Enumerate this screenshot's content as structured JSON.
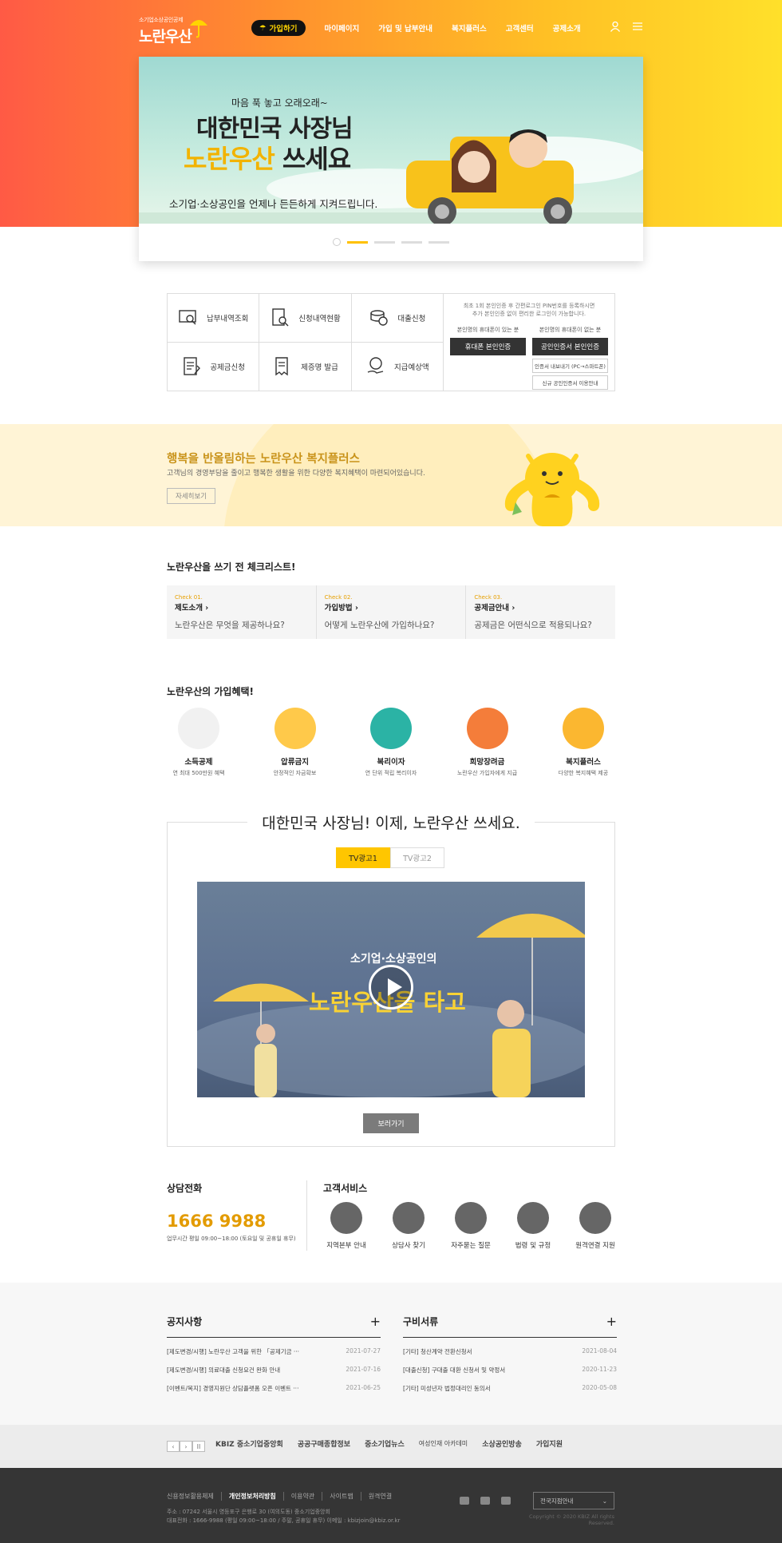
{
  "header": {
    "logo_small": "소기업소상공인공제",
    "logo_main": "노란우산",
    "join_label": "가입하기",
    "nav": [
      "마이페이지",
      "가입 및 납부안내",
      "복지플러스",
      "고객센터",
      "공제소개"
    ]
  },
  "banner": {
    "small": "마음 푹 놓고 오래오래~",
    "title1": "대한민국 사장님",
    "title2a": "노란우산",
    "title2b": "쓰세요",
    "subtitle": "소기업·소상공인을 언제나 든든하게 지켜드립니다."
  },
  "services": {
    "items": [
      {
        "label": "납부내역조회",
        "icon": "monitor-search-icon"
      },
      {
        "label": "신청내역현황",
        "icon": "document-search-icon"
      },
      {
        "label": "대출신청",
        "icon": "coin-stack-icon"
      },
      {
        "label": "공제금신청",
        "icon": "document-pen-icon"
      },
      {
        "label": "제증명 발급",
        "icon": "certificate-icon"
      },
      {
        "label": "지급예상액",
        "icon": "money-hand-icon"
      }
    ],
    "auth_note1": "최초 1회 본인인증 후 간편로그인 PIN번호를 등록하시면",
    "auth_note2": "추가 본인인증 없이 편리한 로그인이 가능합니다.",
    "auth_left_label": "본인명의 휴대폰이 있는 분",
    "auth_right_label": "본인명의 휴대폰이 없는 분",
    "auth_phone_btn": "휴대폰 본인인증",
    "auth_cert_btn": "공인인증서 본인인증",
    "auth_cert_export": "인증서 내보내기 (PC→스마트폰)",
    "auth_cert_guide": "신규 공인인증서 이용안내"
  },
  "welfare": {
    "title": "행복을 반올림하는 노란우산 복지플러스",
    "desc": "고객님의 경영부담을 줄이고 행복한 생활을 위한 다양한 복지혜택이 마련되어있습니다.",
    "button": "자세히보기"
  },
  "checklist": {
    "title": "노란우산을 쓰기 전 체크리스트!",
    "items": [
      {
        "num": "Check 01.",
        "title": "제도소개",
        "desc": "노란우산은 무엇을 제공하나요?"
      },
      {
        "num": "Check 02.",
        "title": "가입방법",
        "desc": "어떻게 노란우산에 가입하나요?"
      },
      {
        "num": "Check 03.",
        "title": "공제금안내",
        "desc": "공제금은 어떤식으로 적용되나요?"
      }
    ]
  },
  "benefits": {
    "title": "노란우산의 가입혜택!",
    "items": [
      {
        "title": "소득공제",
        "desc": "연 최대 500만원 혜택",
        "color": "#f1f1f1"
      },
      {
        "title": "압류금지",
        "desc": "안정적인 자금확보",
        "color": "#ffc94a"
      },
      {
        "title": "복리이자",
        "desc": "연 단위 적립 복리이자",
        "color": "#2bb3a5"
      },
      {
        "title": "희망장려금",
        "desc": "노란우산 가입자에게 지급",
        "color": "#f47d3a"
      },
      {
        "title": "복지플러스",
        "desc": "다양한 복지혜택 제공",
        "color": "#fbb730"
      }
    ]
  },
  "tv": {
    "title": "대한민국 사장님! 이제, 노란우산 쓰세요.",
    "tabs": [
      "TV광고1",
      "TV광고2"
    ],
    "video_small": "소기업·소상공인의",
    "video_big": "노란우산을 타고",
    "button": "보러가기"
  },
  "contact": {
    "title": "상담전화",
    "number": "1666 9988",
    "hours": "업무시간 평일 09:00~18:00 (토요일 및 공휴일 휴무)"
  },
  "customer": {
    "title": "고객서비스",
    "items": [
      "지역본부 안내",
      "상담사 찾기",
      "자주묻는 질문",
      "법령 및 규정",
      "원격연결 지원"
    ]
  },
  "notice": {
    "title": "공지사항",
    "rows": [
      {
        "text": "[제도변경/시행] 노란우산 고객을 위한 「공제기금 ···",
        "date": "2021-07-27"
      },
      {
        "text": "[제도변경/시행] 의료대출 신청요건 완화 안내",
        "date": "2021-07-16"
      },
      {
        "text": "[이벤트/복지] 경영지원단 상담플랫폼 오픈 이벤트 ···",
        "date": "2021-06-25"
      }
    ]
  },
  "docs": {
    "title": "구비서류",
    "rows": [
      {
        "text": "[기타] 청산계약 전환신청서",
        "date": "2021-08-04"
      },
      {
        "text": "[대출신청] 구대출 대환 신청서 및 약정서",
        "date": "2020-11-23"
      },
      {
        "text": "[기타] 미성년자 법정대리인 동의서",
        "date": "2020-05-08"
      }
    ]
  },
  "partners": [
    "KBIZ 중소기업중앙회",
    "공공구매종합정보",
    "중소기업뉴스",
    "여성인재 아카데미",
    "소상공인방송",
    "가입지원"
  ],
  "footer": {
    "links": [
      "신용정보활용체제",
      "개인정보처리방침",
      "이용약관",
      "사이트맵",
      "원격연결"
    ],
    "address1": "주소 : 07242 서울시 영등포구 은행로 30 (여의도동) 중소기업중앙회",
    "address2": "대표전화 : 1666-9988 (평일 09:00~18:00 / 주말, 공휴일 휴무)     이메일 : kbizjoin@kbiz.or.kr",
    "select": "전국지점안내",
    "copyright": "Copyright © 2020 KBIZ All rights Reserved."
  }
}
